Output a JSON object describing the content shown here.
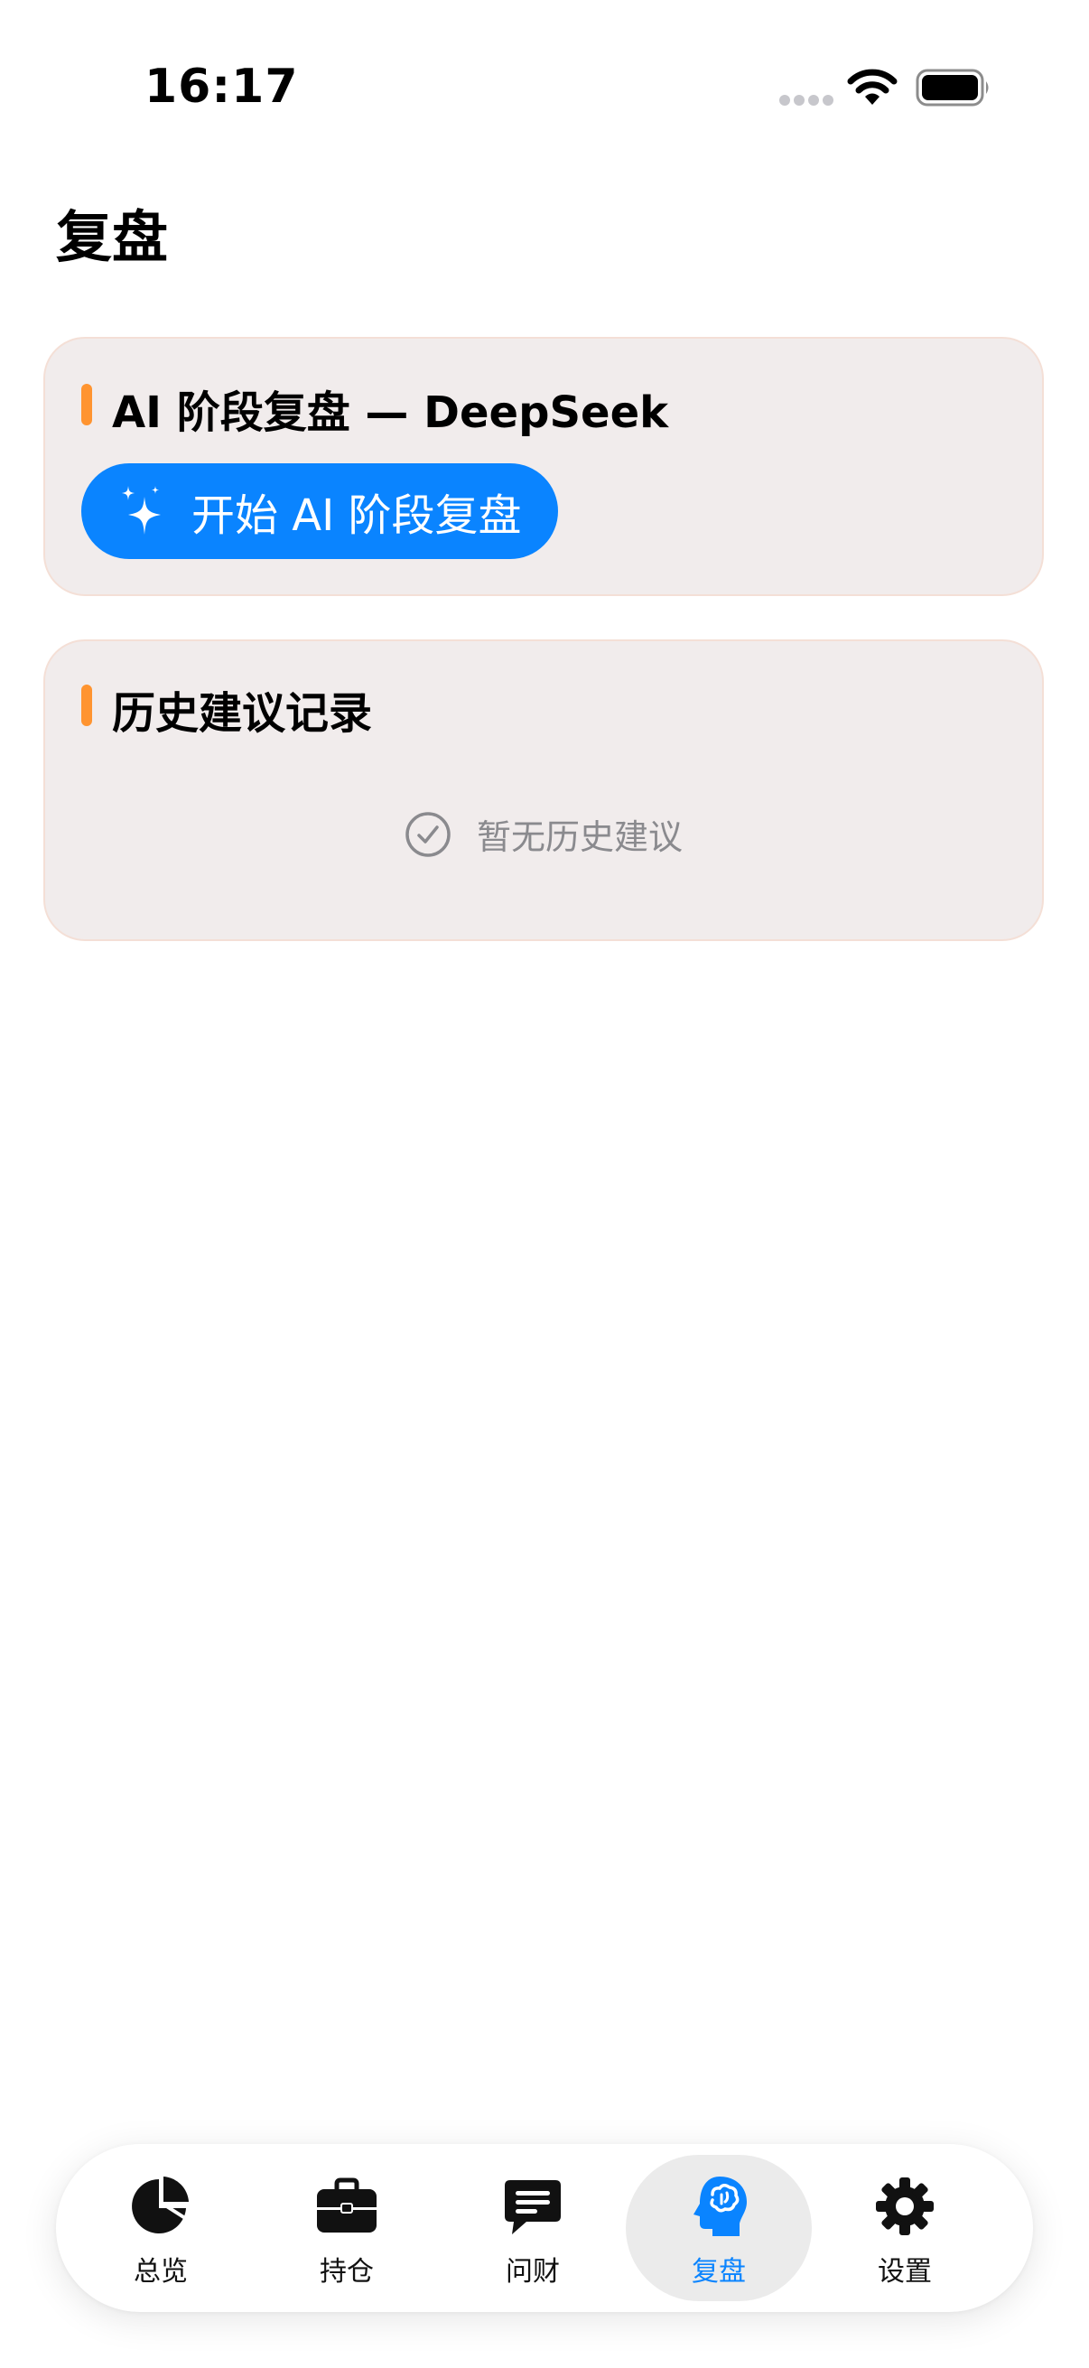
{
  "status_bar": {
    "time": "16:17"
  },
  "page": {
    "title": "复盘"
  },
  "ai_review_card": {
    "title": "AI 阶段复盘 — DeepSeek",
    "button_label": "开始 AI 阶段复盘",
    "button_icon": "sparkles-icon"
  },
  "history_card": {
    "title": "历史建议记录",
    "empty_text": "暂无历史建议",
    "empty_icon": "checkmark-circle-icon"
  },
  "tab_bar": {
    "items": [
      {
        "label": "总览",
        "icon": "pie-chart-icon",
        "active": false
      },
      {
        "label": "持仓",
        "icon": "briefcase-icon",
        "active": false
      },
      {
        "label": "问财",
        "icon": "message-icon",
        "active": false
      },
      {
        "label": "复盘",
        "icon": "brain-head-icon",
        "active": true
      },
      {
        "label": "设置",
        "icon": "gear-icon",
        "active": false
      }
    ]
  },
  "colors": {
    "accent": "#0a84ff",
    "section_marker": "#ff9430",
    "card_background": "#f1ecec",
    "card_border": "#f4dfd6",
    "muted_text": "#8a8a8e"
  }
}
